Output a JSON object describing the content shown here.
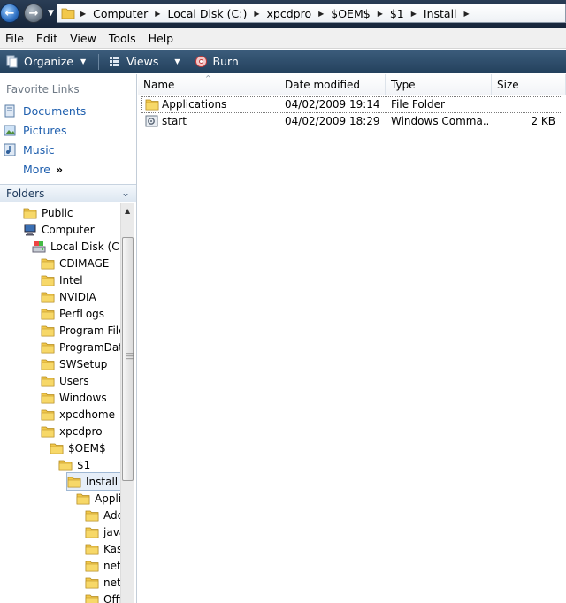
{
  "address": {
    "crumbs": [
      "Computer",
      "Local Disk (C:)",
      "xpcdpro",
      "$OEM$",
      "$1",
      "Install"
    ]
  },
  "menu": [
    "File",
    "Edit",
    "View",
    "Tools",
    "Help"
  ],
  "toolbar": {
    "organize": "Organize",
    "views": "Views",
    "burn": "Burn"
  },
  "favorites": {
    "title": "Favorite Links",
    "items": [
      "Documents",
      "Pictures",
      "Music"
    ],
    "more": "More"
  },
  "folders_header": "Folders",
  "tree": [
    {
      "label": "Public",
      "indent": 1,
      "icon": "folder-icon"
    },
    {
      "label": "Computer",
      "indent": 1,
      "icon": "computer-icon"
    },
    {
      "label": "Local Disk (C:)",
      "indent": 2,
      "icon": "drive-icon"
    },
    {
      "label": "CDIMAGE",
      "indent": 3,
      "icon": "folder-icon"
    },
    {
      "label": "Intel",
      "indent": 3,
      "icon": "folder-icon"
    },
    {
      "label": "NVIDIA",
      "indent": 3,
      "icon": "folder-icon"
    },
    {
      "label": "PerfLogs",
      "indent": 3,
      "icon": "folder-icon"
    },
    {
      "label": "Program Files",
      "indent": 3,
      "icon": "folder-icon"
    },
    {
      "label": "ProgramData",
      "indent": 3,
      "icon": "folder-icon"
    },
    {
      "label": "SWSetup",
      "indent": 3,
      "icon": "folder-icon"
    },
    {
      "label": "Users",
      "indent": 3,
      "icon": "folder-icon"
    },
    {
      "label": "Windows",
      "indent": 3,
      "icon": "folder-icon"
    },
    {
      "label": "xpcdhome",
      "indent": 3,
      "icon": "folder-icon"
    },
    {
      "label": "xpcdpro",
      "indent": 3,
      "icon": "folder-icon"
    },
    {
      "label": "$OEM$",
      "indent": 4,
      "icon": "folder-icon"
    },
    {
      "label": "$1",
      "indent": 5,
      "icon": "folder-icon"
    },
    {
      "label": "Install",
      "indent": 6,
      "icon": "folder-icon",
      "selected": true
    },
    {
      "label": "Applications",
      "indent": 7,
      "icon": "folder-icon"
    },
    {
      "label": "Adobe",
      "indent": 8,
      "icon": "folder-icon"
    },
    {
      "label": "java",
      "indent": 8,
      "icon": "folder-icon"
    },
    {
      "label": "Kaspersky",
      "indent": 8,
      "icon": "folder-icon"
    },
    {
      "label": "net",
      "indent": 8,
      "icon": "folder-icon"
    },
    {
      "label": "net",
      "indent": 8,
      "icon": "folder-icon"
    },
    {
      "label": "Office",
      "indent": 8,
      "icon": "folder-icon"
    }
  ],
  "columns": [
    "Name",
    "Date modified",
    "Type",
    "Size"
  ],
  "files": [
    {
      "name": "Applications",
      "date": "04/02/2009 19:14",
      "type": "File Folder",
      "size": "",
      "icon": "folder-icon"
    },
    {
      "name": "start",
      "date": "04/02/2009 18:29",
      "type": "Windows Comma...",
      "size": "2 KB",
      "icon": "command-script-icon"
    }
  ],
  "colors": {
    "link": "#1f5fae",
    "folder": "#f2c84b",
    "toolbar": "#2e4d6b"
  }
}
